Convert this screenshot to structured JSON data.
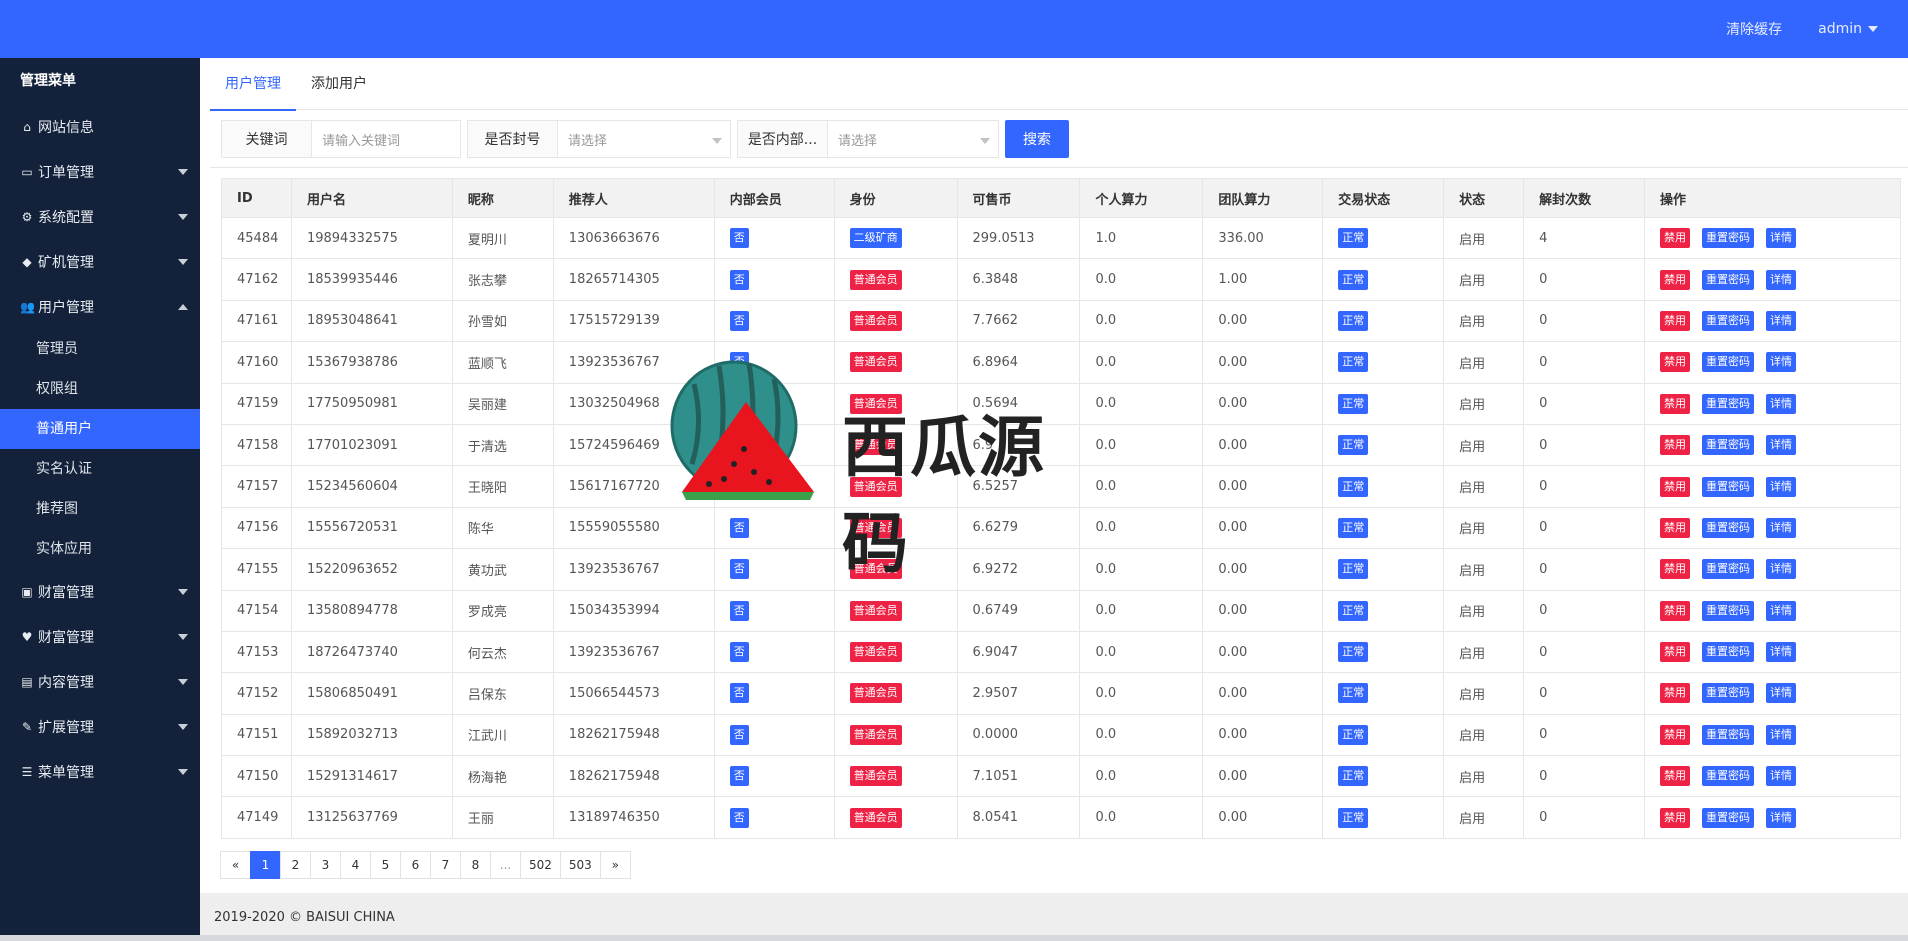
{
  "header": {
    "clear_cache": "清除缓存",
    "user": "admin"
  },
  "sidebar": {
    "title": "管理菜单",
    "items": [
      {
        "label": "网站信息",
        "icon": "home-icon",
        "glyph": "⌂",
        "arrow": "none"
      },
      {
        "label": "订单管理",
        "icon": "credit-card-icon",
        "glyph": "▭",
        "arrow": "down"
      },
      {
        "label": "系统配置",
        "icon": "gears-icon",
        "glyph": "⚙",
        "arrow": "down"
      },
      {
        "label": "矿机管理",
        "icon": "cube-icon",
        "glyph": "◆",
        "arrow": "down"
      },
      {
        "label": "用户管理",
        "icon": "users-icon",
        "glyph": "👥",
        "arrow": "up"
      },
      {
        "label": "财富管理",
        "icon": "money-icon",
        "glyph": "▣",
        "arrow": "down"
      },
      {
        "label": "财富管理",
        "icon": "heartbeat-icon",
        "glyph": "♥",
        "arrow": "down"
      },
      {
        "label": "内容管理",
        "icon": "file-icon",
        "glyph": "▤",
        "arrow": "down"
      },
      {
        "label": "扩展管理",
        "icon": "wrench-icon",
        "glyph": "✎",
        "arrow": "down"
      },
      {
        "label": "菜单管理",
        "icon": "bars-icon",
        "glyph": "☰",
        "arrow": "down"
      }
    ],
    "sub_items": [
      "管理员",
      "权限组",
      "普通用户",
      "实名认证",
      "推荐图",
      "实体应用"
    ]
  },
  "tabs": [
    "用户管理",
    "添加用户"
  ],
  "filters": {
    "keyword_label": "关键词",
    "keyword_placeholder": "请输入关键词",
    "banned_label": "是否封号",
    "banned_value": "请选择",
    "internal_label": "是否内部...",
    "internal_value": "请选择",
    "search_button": "搜索"
  },
  "table": {
    "columns": [
      "ID",
      "用户名",
      "昵称",
      "推荐人",
      "内部会员",
      "身份",
      "可售币",
      "个人算力",
      "团队算力",
      "交易状态",
      "状态",
      "解封次数",
      "操作"
    ],
    "actions": [
      "禁用",
      "重置密码",
      "详情"
    ],
    "rows": [
      [
        "45484",
        "19894332575",
        "夏明川",
        "13063663676",
        "否",
        "二级矿商",
        "299.0513",
        "1.0",
        "336.00",
        "正常",
        "启用",
        "4"
      ],
      [
        "47162",
        "18539935446",
        "张志攀",
        "18265714305",
        "否",
        "普通会员",
        "6.3848",
        "0.0",
        "1.00",
        "正常",
        "启用",
        "0"
      ],
      [
        "47161",
        "18953048641",
        "孙雪如",
        "17515729139",
        "否",
        "普通会员",
        "7.7662",
        "0.0",
        "0.00",
        "正常",
        "启用",
        "0"
      ],
      [
        "47160",
        "15367938786",
        "蓝顺飞",
        "13923536767",
        "否",
        "普通会员",
        "6.8964",
        "0.0",
        "0.00",
        "正常",
        "启用",
        "0"
      ],
      [
        "47159",
        "17750950981",
        "吴丽建",
        "13032504968",
        "否",
        "普通会员",
        "0.5694",
        "0.0",
        "0.00",
        "正常",
        "启用",
        "0"
      ],
      [
        "47158",
        "17701023091",
        "于清选",
        "15724596469",
        "否",
        "普通会员",
        "6.9",
        "0.0",
        "0.00",
        "正常",
        "启用",
        "0"
      ],
      [
        "47157",
        "15234560604",
        "王晓阳",
        "15617167720",
        "否",
        "普通会员",
        "6.5257",
        "0.0",
        "0.00",
        "正常",
        "启用",
        "0"
      ],
      [
        "47156",
        "15556720531",
        "陈华",
        "15559055580",
        "否",
        "普通会员",
        "6.6279",
        "0.0",
        "0.00",
        "正常",
        "启用",
        "0"
      ],
      [
        "47155",
        "15220963652",
        "黄功武",
        "13923536767",
        "否",
        "普通会员",
        "6.9272",
        "0.0",
        "0.00",
        "正常",
        "启用",
        "0"
      ],
      [
        "47154",
        "13580894778",
        "罗成亮",
        "15034353994",
        "否",
        "普通会员",
        "0.6749",
        "0.0",
        "0.00",
        "正常",
        "启用",
        "0"
      ],
      [
        "47153",
        "18726473740",
        "何云杰",
        "13923536767",
        "否",
        "普通会员",
        "6.9047",
        "0.0",
        "0.00",
        "正常",
        "启用",
        "0"
      ],
      [
        "47152",
        "15806850491",
        "吕保东",
        "15066544573",
        "否",
        "普通会员",
        "2.9507",
        "0.0",
        "0.00",
        "正常",
        "启用",
        "0"
      ],
      [
        "47151",
        "15892032713",
        "江武川",
        "18262175948",
        "否",
        "普通会员",
        "0.0000",
        "0.0",
        "0.00",
        "正常",
        "启用",
        "0"
      ],
      [
        "47150",
        "15291314617",
        "杨海艳",
        "18262175948",
        "否",
        "普通会员",
        "7.1051",
        "0.0",
        "0.00",
        "正常",
        "启用",
        "0"
      ],
      [
        "47149",
        "13125637769",
        "王丽",
        "13189746350",
        "否",
        "普通会员",
        "8.0541",
        "0.0",
        "0.00",
        "正常",
        "启用",
        "0"
      ]
    ]
  },
  "pagination": {
    "prev": "«",
    "next": "»",
    "pages": [
      "1",
      "2",
      "3",
      "4",
      "5",
      "6",
      "7",
      "8",
      "...",
      "502",
      "503"
    ],
    "current": "1"
  },
  "footer": {
    "text": "2019-2020 © BAISUI CHINA"
  },
  "watermark": {
    "text": "西瓜源码"
  },
  "colors": {
    "accent": "#3366ff",
    "sidebar": "#13223a",
    "danger": "#ee2244"
  }
}
